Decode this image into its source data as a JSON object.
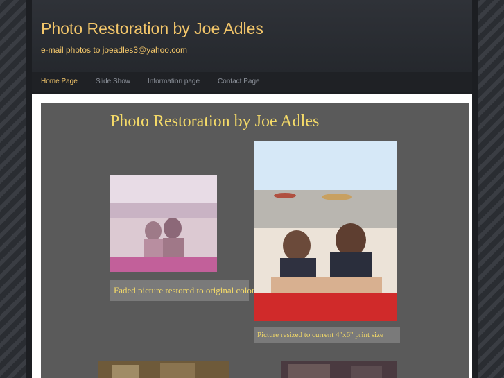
{
  "header": {
    "title": "Photo Restoration by Joe Adles",
    "tagline": "e-mail photos to joeadles3@yahoo.com"
  },
  "nav": {
    "items": [
      {
        "label": "Home Page",
        "active": true
      },
      {
        "label": "Slide Show",
        "active": false
      },
      {
        "label": "Information page",
        "active": false
      },
      {
        "label": "Contact Page",
        "active": false
      }
    ]
  },
  "main": {
    "banner_title": "Photo Restoration by Joe Adles",
    "captions": {
      "faded": "Faded picture restored to original color.",
      "resized": "Picture resized to current 4\"x6\" print size"
    }
  },
  "colors": {
    "accent": "#f3c66a",
    "caption_text": "#f4da68",
    "content_bg": "#5a5a5a"
  }
}
